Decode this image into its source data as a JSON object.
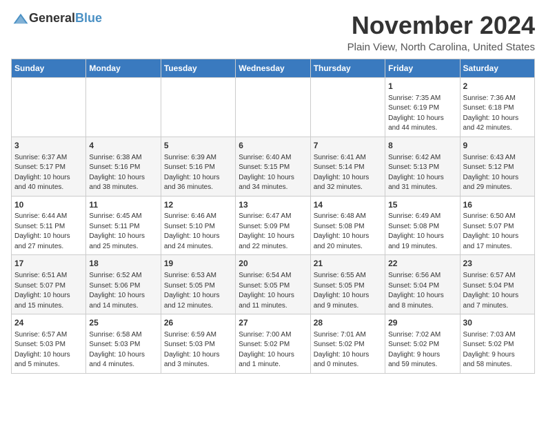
{
  "header": {
    "logo_general": "General",
    "logo_blue": "Blue",
    "month_title": "November 2024",
    "location": "Plain View, North Carolina, United States"
  },
  "weekdays": [
    "Sunday",
    "Monday",
    "Tuesday",
    "Wednesday",
    "Thursday",
    "Friday",
    "Saturday"
  ],
  "weeks": [
    [
      {
        "day": "",
        "info": ""
      },
      {
        "day": "",
        "info": ""
      },
      {
        "day": "",
        "info": ""
      },
      {
        "day": "",
        "info": ""
      },
      {
        "day": "",
        "info": ""
      },
      {
        "day": "1",
        "info": "Sunrise: 7:35 AM\nSunset: 6:19 PM\nDaylight: 10 hours\nand 44 minutes."
      },
      {
        "day": "2",
        "info": "Sunrise: 7:36 AM\nSunset: 6:18 PM\nDaylight: 10 hours\nand 42 minutes."
      }
    ],
    [
      {
        "day": "3",
        "info": "Sunrise: 6:37 AM\nSunset: 5:17 PM\nDaylight: 10 hours\nand 40 minutes."
      },
      {
        "day": "4",
        "info": "Sunrise: 6:38 AM\nSunset: 5:16 PM\nDaylight: 10 hours\nand 38 minutes."
      },
      {
        "day": "5",
        "info": "Sunrise: 6:39 AM\nSunset: 5:16 PM\nDaylight: 10 hours\nand 36 minutes."
      },
      {
        "day": "6",
        "info": "Sunrise: 6:40 AM\nSunset: 5:15 PM\nDaylight: 10 hours\nand 34 minutes."
      },
      {
        "day": "7",
        "info": "Sunrise: 6:41 AM\nSunset: 5:14 PM\nDaylight: 10 hours\nand 32 minutes."
      },
      {
        "day": "8",
        "info": "Sunrise: 6:42 AM\nSunset: 5:13 PM\nDaylight: 10 hours\nand 31 minutes."
      },
      {
        "day": "9",
        "info": "Sunrise: 6:43 AM\nSunset: 5:12 PM\nDaylight: 10 hours\nand 29 minutes."
      }
    ],
    [
      {
        "day": "10",
        "info": "Sunrise: 6:44 AM\nSunset: 5:11 PM\nDaylight: 10 hours\nand 27 minutes."
      },
      {
        "day": "11",
        "info": "Sunrise: 6:45 AM\nSunset: 5:11 PM\nDaylight: 10 hours\nand 25 minutes."
      },
      {
        "day": "12",
        "info": "Sunrise: 6:46 AM\nSunset: 5:10 PM\nDaylight: 10 hours\nand 24 minutes."
      },
      {
        "day": "13",
        "info": "Sunrise: 6:47 AM\nSunset: 5:09 PM\nDaylight: 10 hours\nand 22 minutes."
      },
      {
        "day": "14",
        "info": "Sunrise: 6:48 AM\nSunset: 5:08 PM\nDaylight: 10 hours\nand 20 minutes."
      },
      {
        "day": "15",
        "info": "Sunrise: 6:49 AM\nSunset: 5:08 PM\nDaylight: 10 hours\nand 19 minutes."
      },
      {
        "day": "16",
        "info": "Sunrise: 6:50 AM\nSunset: 5:07 PM\nDaylight: 10 hours\nand 17 minutes."
      }
    ],
    [
      {
        "day": "17",
        "info": "Sunrise: 6:51 AM\nSunset: 5:07 PM\nDaylight: 10 hours\nand 15 minutes."
      },
      {
        "day": "18",
        "info": "Sunrise: 6:52 AM\nSunset: 5:06 PM\nDaylight: 10 hours\nand 14 minutes."
      },
      {
        "day": "19",
        "info": "Sunrise: 6:53 AM\nSunset: 5:05 PM\nDaylight: 10 hours\nand 12 minutes."
      },
      {
        "day": "20",
        "info": "Sunrise: 6:54 AM\nSunset: 5:05 PM\nDaylight: 10 hours\nand 11 minutes."
      },
      {
        "day": "21",
        "info": "Sunrise: 6:55 AM\nSunset: 5:05 PM\nDaylight: 10 hours\nand 9 minutes."
      },
      {
        "day": "22",
        "info": "Sunrise: 6:56 AM\nSunset: 5:04 PM\nDaylight: 10 hours\nand 8 minutes."
      },
      {
        "day": "23",
        "info": "Sunrise: 6:57 AM\nSunset: 5:04 PM\nDaylight: 10 hours\nand 7 minutes."
      }
    ],
    [
      {
        "day": "24",
        "info": "Sunrise: 6:57 AM\nSunset: 5:03 PM\nDaylight: 10 hours\nand 5 minutes."
      },
      {
        "day": "25",
        "info": "Sunrise: 6:58 AM\nSunset: 5:03 PM\nDaylight: 10 hours\nand 4 minutes."
      },
      {
        "day": "26",
        "info": "Sunrise: 6:59 AM\nSunset: 5:03 PM\nDaylight: 10 hours\nand 3 minutes."
      },
      {
        "day": "27",
        "info": "Sunrise: 7:00 AM\nSunset: 5:02 PM\nDaylight: 10 hours\nand 1 minute."
      },
      {
        "day": "28",
        "info": "Sunrise: 7:01 AM\nSunset: 5:02 PM\nDaylight: 10 hours\nand 0 minutes."
      },
      {
        "day": "29",
        "info": "Sunrise: 7:02 AM\nSunset: 5:02 PM\nDaylight: 9 hours\nand 59 minutes."
      },
      {
        "day": "30",
        "info": "Sunrise: 7:03 AM\nSunset: 5:02 PM\nDaylight: 9 hours\nand 58 minutes."
      }
    ]
  ]
}
